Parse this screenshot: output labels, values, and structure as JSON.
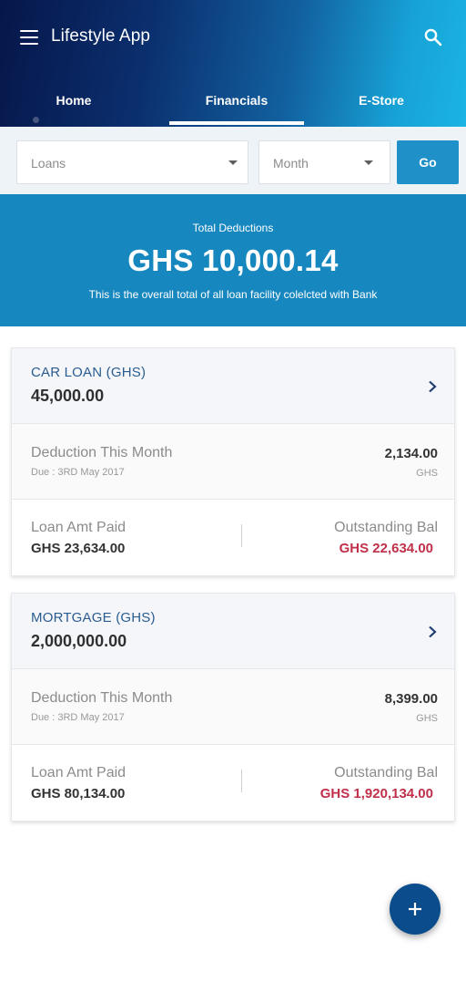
{
  "appbar": {
    "title": "Lifestyle App",
    "menu_icon": "hamburger-menu-icon",
    "search_icon": "search-icon",
    "gradient_colors": [
      "#06174a",
      "#12609f",
      "#1bb4e3"
    ]
  },
  "tabs": [
    {
      "label": "Home",
      "active": false
    },
    {
      "label": "Financials",
      "active": true
    },
    {
      "label": "E-Store",
      "active": false
    }
  ],
  "filters": {
    "loan_type": "Loans",
    "period": "Month",
    "go_label": "Go"
  },
  "summary": {
    "label": "Total Deductions",
    "amount": "GHS 10,000.14",
    "description": "This is the overall total of all loan facility colelcted with Bank",
    "background": "#1787bf"
  },
  "loans": [
    {
      "title": "CAR LOAN (GHS)",
      "amount": "45,000.00",
      "deduction_label": "Deduction This Month",
      "due": "Due : 3RD May 2017",
      "deduction_amount": "2,134.00",
      "deduction_unit": "GHS",
      "paid_label": "Loan Amt Paid",
      "paid_amount": "GHS 23,634.00",
      "outstanding_label": "Outstanding Bal",
      "outstanding_amount": "GHS 22,634.00"
    },
    {
      "title": "MORTGAGE (GHS)",
      "amount": "2,000,000.00",
      "deduction_label": "Deduction This Month",
      "due": "Due : 3RD May 2017",
      "deduction_amount": "8,399.00",
      "deduction_unit": "GHS",
      "paid_label": "Loan Amt Paid",
      "paid_amount": "GHS 80,134.00",
      "outstanding_label": "Outstanding Bal",
      "outstanding_amount": "GHS 1,920,134.00"
    }
  ],
  "colors": {
    "accent": "#1f91c8",
    "title_blue": "#2a5c8f",
    "outstanding_red": "#c0304a",
    "fab": "#0b4d8c"
  },
  "fab": {
    "icon": "plus-icon"
  }
}
